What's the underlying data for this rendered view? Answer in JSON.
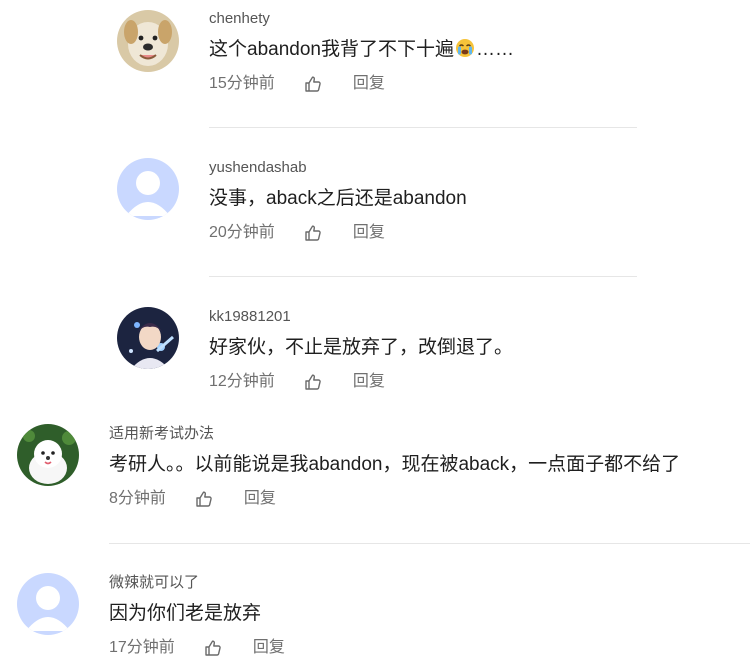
{
  "comments": [
    {
      "username": "chenhety",
      "text_before_emoji": "这个abandon我背了不下十遍",
      "emoji": "tearful-emoji",
      "text_after_emoji": "……",
      "time": "15分钟前",
      "reply_label": "回复",
      "avatar": "dog-avatar"
    },
    {
      "username": "yushendashab",
      "text": "没事，aback之后还是abandon",
      "time": "20分钟前",
      "reply_label": "回复",
      "avatar": "default-avatar"
    },
    {
      "username": "kk19881201",
      "text": "好家伙，不止是放弃了，改倒退了。",
      "time": "12分钟前",
      "reply_label": "回复",
      "avatar": "anime-avatar"
    },
    {
      "username": "适用新考试办法",
      "text": "考研人。。以前能说是我abandon，现在被aback，一点面子都不给了",
      "time": "8分钟前",
      "reply_label": "回复",
      "avatar": "white-dog-avatar"
    },
    {
      "username": "微辣就可以了",
      "text": "因为你们老是放弃",
      "time": "17分钟前",
      "reply_label": "回复",
      "avatar": "default-avatar"
    }
  ],
  "colors": {
    "default_avatar_bg": "#c9d8ff",
    "text": "#1f1f1f",
    "muted": "#707070",
    "divider": "#e6e6e6"
  }
}
